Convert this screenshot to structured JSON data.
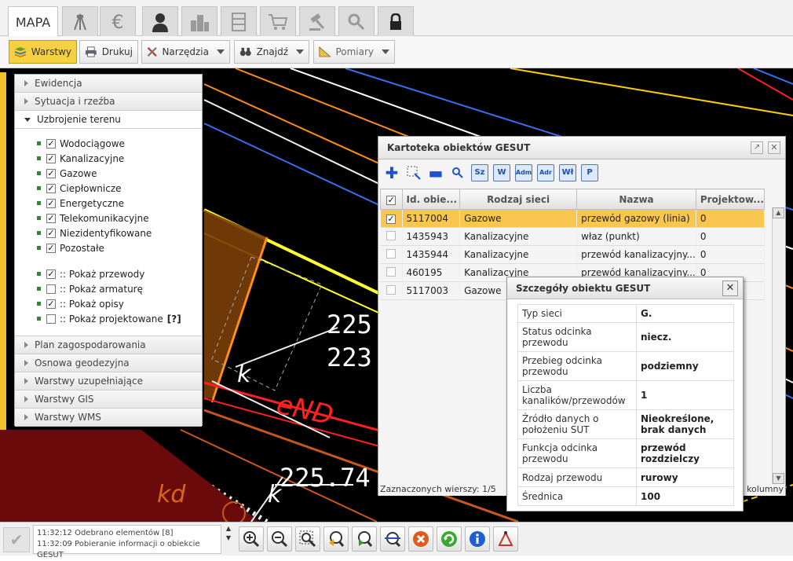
{
  "tabs": {
    "active": "MAPA",
    "icons": [
      "surveyor-icon",
      "euro-icon",
      "person-icon",
      "buildings-icon",
      "cabinet-icon",
      "cart-icon",
      "gavel-icon",
      "search-icon",
      "lock-icon"
    ]
  },
  "toolbar": {
    "layers": "Warstwy",
    "print": "Drukuj",
    "tools": "Narzędzia",
    "find": "Znajdź",
    "measure": "Pomiary"
  },
  "map_labels": {
    "elev1": "225.",
    "elev2": "223.",
    "elev3": "225.74",
    "k1": "k",
    "k2": "k",
    "end": "eND",
    "kd": "kd"
  },
  "layers": {
    "headers_top": [
      "Ewidencja",
      "Sytuacja i rzeźba"
    ],
    "open": "Uzbrojenie terenu",
    "items": [
      {
        "label": "Wodociągowe",
        "checked": true
      },
      {
        "label": "Kanalizacyjne",
        "checked": true
      },
      {
        "label": "Gazowe",
        "checked": true
      },
      {
        "label": "Ciepłownicze",
        "checked": true
      },
      {
        "label": "Energetyczne",
        "checked": true
      },
      {
        "label": "Telekomunikacyjne",
        "checked": true
      },
      {
        "label": "Niezidentyfikowane",
        "checked": true
      },
      {
        "label": "Pozostałe",
        "checked": true
      }
    ],
    "options": [
      {
        "label": ":: Pokaż przewody",
        "checked": true
      },
      {
        "label": ":: Pokaż armaturę",
        "checked": false
      },
      {
        "label": ":: Pokaż opisy",
        "checked": true
      },
      {
        "label": ":: Pokaż projektowane",
        "extra": "[?]",
        "checked": false
      }
    ],
    "headers_bottom": [
      "Plan zagospodarowania",
      "Osnowa geodezyjna",
      "Warstwy uzupełniające",
      "Warstwy GIS",
      "Warstwy WMS"
    ]
  },
  "kartoteka": {
    "title": "Kartoteka obiektów GESUT",
    "columns": [
      "Id. obie...",
      "Rodzaj sieci",
      "Nazwa",
      "Projektow..."
    ],
    "rows": [
      {
        "id": "5117004",
        "type": "Gazowe",
        "name": "przewód gazowy (linia)",
        "proj": "0",
        "selected": true
      },
      {
        "id": "1435943",
        "type": "Kanalizacyjne",
        "name": "właz (punkt)",
        "proj": "0",
        "selected": false
      },
      {
        "id": "1435944",
        "type": "Kanalizacyjne",
        "name": "przewód kanalizacyjny...",
        "proj": "0",
        "selected": false
      },
      {
        "id": "460195",
        "type": "Kanalizacyjne",
        "name": "przewód kanalizacyjny...",
        "proj": "0",
        "selected": false
      },
      {
        "id": "5117003",
        "type": "Gazowe",
        "name": "",
        "proj": "",
        "selected": false
      }
    ],
    "footer": "Zaznaczonych wierszy: 1/5",
    "footer_right": "kolumny",
    "tool_labels": [
      "Sz",
      "W",
      "Adm",
      "Adr",
      "Wł",
      "P"
    ]
  },
  "details": {
    "title": "Szczegóły obiektu GESUT",
    "rows": [
      {
        "k": "Typ sieci",
        "v": "G."
      },
      {
        "k": "Status odcinka przewodu",
        "v": "niecz."
      },
      {
        "k": "Przebieg odcinka przewodu",
        "v": "podziemny"
      },
      {
        "k": "Liczba kanalików/przewodów",
        "v": "1"
      },
      {
        "k": "Źródło danych o położeniu SUT",
        "v": "Nieokreślone, brak danych"
      },
      {
        "k": "Funkcja odcinka przewodu",
        "v": "przewód rozdzielczy"
      },
      {
        "k": "Rodzaj przewodu",
        "v": "rurowy"
      },
      {
        "k": "Średnica",
        "v": "100"
      }
    ]
  },
  "status": {
    "log1": "11:32:12 Odebrano elementów [8]",
    "log2": "11:32:09 Pobieranie informacji o obiekcie GESUT"
  }
}
